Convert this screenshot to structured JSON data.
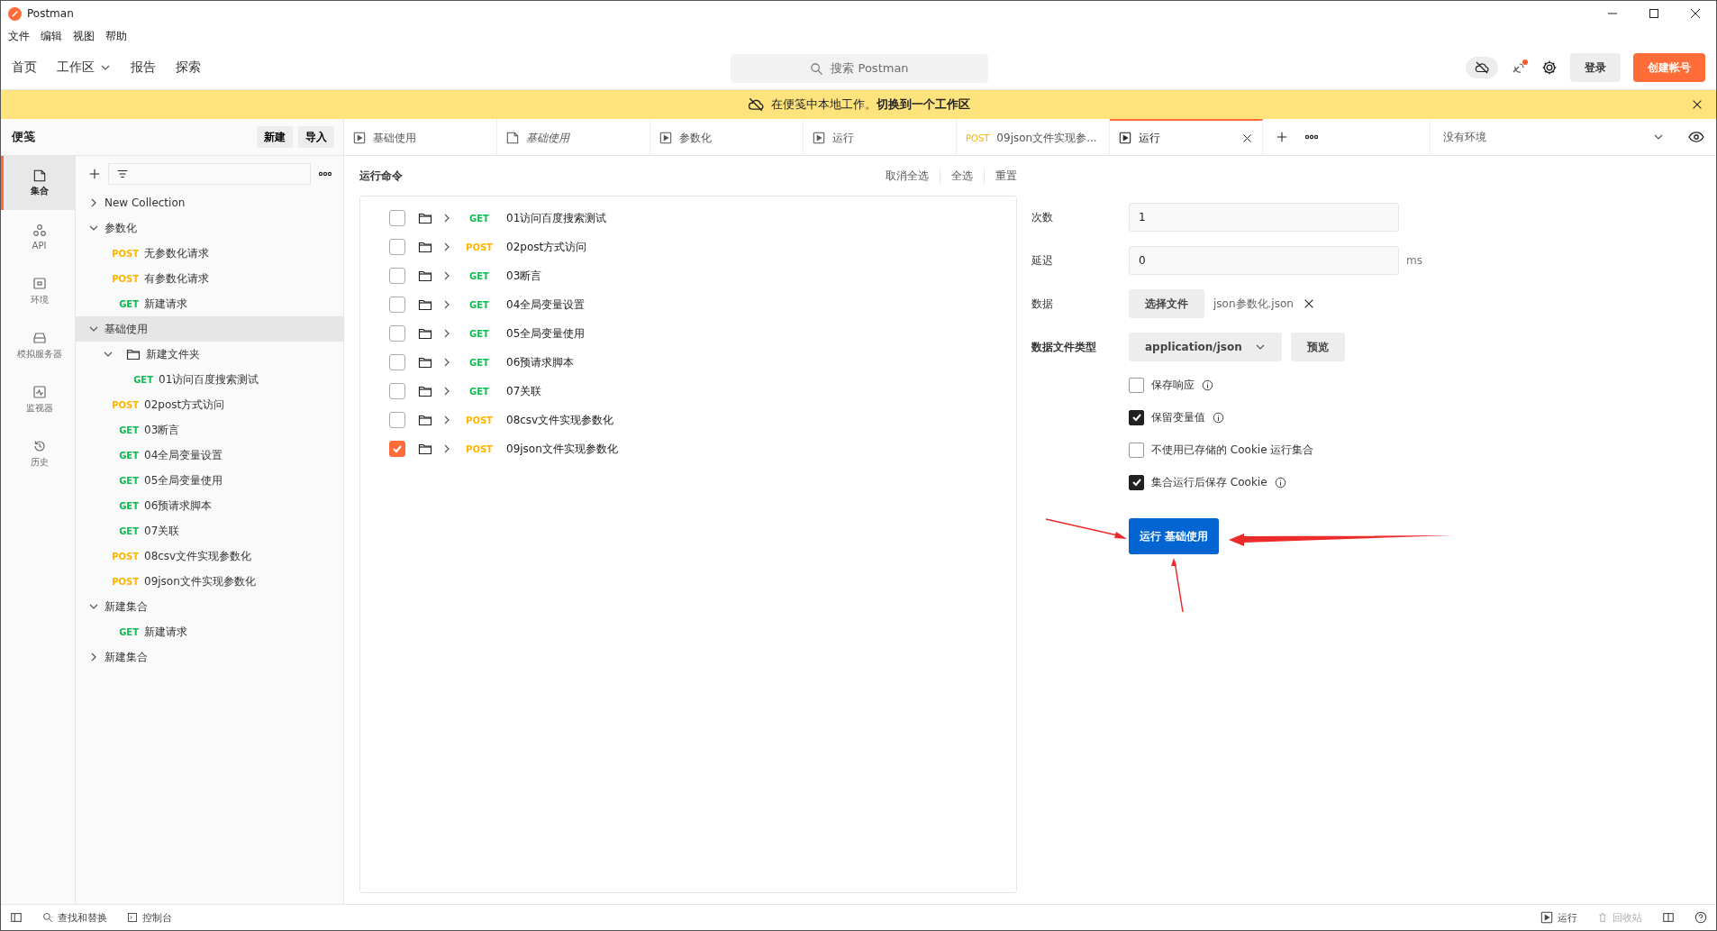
{
  "window": {
    "title": "Postman"
  },
  "menu": [
    "文件",
    "编辑",
    "视图",
    "帮助"
  ],
  "nav": [
    {
      "label": "首页",
      "dropdown": false
    },
    {
      "label": "工作区",
      "dropdown": true
    },
    {
      "label": "报告",
      "dropdown": false
    },
    {
      "label": "探索",
      "dropdown": false
    }
  ],
  "search": {
    "placeholder": "搜索 Postman"
  },
  "header_buttons": {
    "sign_in": "登录",
    "create_account": "创建帐号"
  },
  "banner": {
    "text": "在便笺中本地工作。**切换到一个工作区**"
  },
  "sidebar": {
    "title": "便笺",
    "buttons": [
      "新建",
      "导入"
    ],
    "rail": [
      {
        "label": "集合",
        "selected": true
      },
      {
        "label": "API",
        "selected": false
      },
      {
        "label": "环境",
        "selected": false
      },
      {
        "label": "模拟服务器",
        "selected": false
      },
      {
        "label": "监视器",
        "selected": false
      },
      {
        "label": "历史",
        "selected": false
      }
    ],
    "tree": [
      {
        "kind": "collection",
        "name": "New Collection",
        "expanded": false,
        "selected": false
      },
      {
        "kind": "collection",
        "name": "参数化",
        "expanded": true,
        "selected": false,
        "children": [
          {
            "kind": "request",
            "method": "POST",
            "color": "#ffb400",
            "name": "无参数化请求",
            "selected": false
          },
          {
            "kind": "request",
            "method": "POST",
            "color": "#ffb400",
            "name": "有参数化请求",
            "selected": false
          },
          {
            "kind": "request",
            "method": "GET",
            "color": "#0cbb52",
            "name": "新建请求",
            "selected": false
          }
        ]
      },
      {
        "kind": "collection",
        "name": "基础使用",
        "expanded": true,
        "selected": true,
        "children": [
          {
            "kind": "folder",
            "name": "新建文件夹",
            "expanded": true,
            "selected": false,
            "children": [
              {
                "kind": "request",
                "method": "GET",
                "color": "#0cbb52",
                "name": "01访问百度搜索测试",
                "selected": false
              }
            ]
          },
          {
            "kind": "request",
            "method": "POST",
            "color": "#ffb400",
            "name": "02post方式访问",
            "selected": false
          },
          {
            "kind": "request",
            "method": "GET",
            "color": "#0cbb52",
            "name": "03断言",
            "selected": false
          },
          {
            "kind": "request",
            "method": "GET",
            "color": "#0cbb52",
            "name": "04全局变量设置",
            "selected": false
          },
          {
            "kind": "request",
            "method": "GET",
            "color": "#0cbb52",
            "name": "05全局变量使用",
            "selected": false
          },
          {
            "kind": "request",
            "method": "GET",
            "color": "#0cbb52",
            "name": "06预请求脚本",
            "selected": false
          },
          {
            "kind": "request",
            "method": "GET",
            "color": "#0cbb52",
            "name": "07关联",
            "selected": false
          },
          {
            "kind": "request",
            "method": "POST",
            "color": "#ffb400",
            "name": "08csv文件实现参数化",
            "selected": false
          },
          {
            "kind": "request",
            "method": "POST",
            "color": "#ffb400",
            "name": "09json文件实现参数化",
            "selected": false
          }
        ]
      },
      {
        "kind": "collection",
        "name": "新建集合",
        "expanded": true,
        "selected": false,
        "children": [
          {
            "kind": "request",
            "method": "GET",
            "color": "#0cbb52",
            "name": "新建请求",
            "selected": false
          }
        ]
      },
      {
        "kind": "collection",
        "name": "新建集合",
        "expanded": false,
        "selected": false
      }
    ]
  },
  "tabs": [
    {
      "kind": "runner",
      "label": "基础使用",
      "italic": false,
      "selected": false
    },
    {
      "kind": "collection",
      "label": "基础使用",
      "italic": true,
      "selected": false
    },
    {
      "kind": "runner",
      "label": "参数化",
      "italic": false,
      "selected": false
    },
    {
      "kind": "runner",
      "label": "运行",
      "italic": false,
      "selected": false
    },
    {
      "kind": "request",
      "method": "POST",
      "color": "#ffb400",
      "label": "09json文件实现参...",
      "italic": false,
      "selected": false
    },
    {
      "kind": "runner",
      "label": "运行",
      "italic": false,
      "selected": true
    }
  ],
  "environment": {
    "label": "没有环境"
  },
  "runner": {
    "title": "运行命令",
    "actions": [
      "取消全选",
      "全选",
      "重置"
    ],
    "requests": [
      {
        "method": "GET",
        "color": "#0cbb52",
        "name": "01访问百度搜索测试",
        "checked": false
      },
      {
        "method": "POST",
        "color": "#ffb400",
        "name": "02post方式访问",
        "checked": false
      },
      {
        "method": "GET",
        "color": "#0cbb52",
        "name": "03断言",
        "checked": false
      },
      {
        "method": "GET",
        "color": "#0cbb52",
        "name": "04全局变量设置",
        "checked": false
      },
      {
        "method": "GET",
        "color": "#0cbb52",
        "name": "05全局变量使用",
        "checked": false
      },
      {
        "method": "GET",
        "color": "#0cbb52",
        "name": "06预请求脚本",
        "checked": false
      },
      {
        "method": "GET",
        "color": "#0cbb52",
        "name": "07关联",
        "checked": false
      },
      {
        "method": "POST",
        "color": "#ffb400",
        "name": "08csv文件实现参数化",
        "checked": false
      },
      {
        "method": "POST",
        "color": "#ffb400",
        "name": "09json文件实现参数化",
        "checked": true
      }
    ],
    "settings": {
      "iterations": {
        "label": "次数",
        "value": "1"
      },
      "delay": {
        "label": "延迟",
        "value": "0",
        "unit": "ms"
      },
      "data": {
        "label": "数据",
        "button": "选择文件",
        "file": "json参数化.json"
      },
      "data_type": {
        "label": "数据文件类型",
        "value": "application/json",
        "button": "预览"
      },
      "options": [
        {
          "label": "保存响应",
          "checked": false,
          "info": true
        },
        {
          "label": "保留变量值",
          "checked": true,
          "info": true
        },
        {
          "label": "不使用已存储的 Cookie 运行集合",
          "checked": false,
          "info": false
        },
        {
          "label": "集合运行后保存 Cookie",
          "checked": true,
          "info": true
        }
      ],
      "run_button": "运行 基础使用"
    }
  },
  "status_bar": {
    "left": [
      "查找和替换",
      "控制台"
    ],
    "right": [
      "运行",
      "回收站"
    ]
  }
}
